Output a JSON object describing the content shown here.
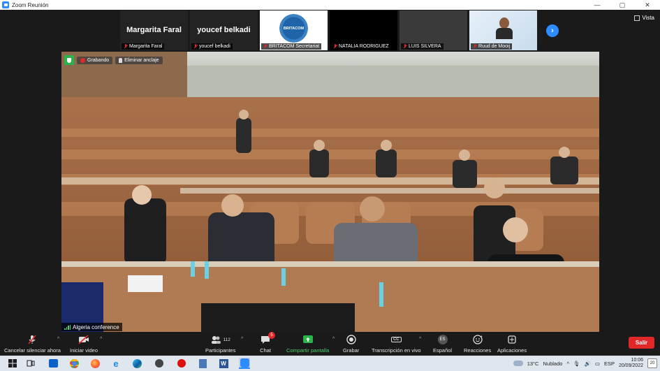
{
  "window": {
    "title": "Zoom Reunión",
    "minimize": "—",
    "maximize": "▢",
    "close": "✕"
  },
  "view_button": {
    "label": "Vista"
  },
  "gallery": [
    {
      "name": "Margarita Faral",
      "display": "Margarita Faral",
      "type": "name"
    },
    {
      "name": "youcef belkadi",
      "display": "youcef belkadi",
      "type": "name"
    },
    {
      "name": "BRITACOM Secretariat",
      "display": "BRITACOM",
      "type": "logo"
    },
    {
      "name": "NATALIA RODRIGUEZ",
      "display": "",
      "type": "dark"
    },
    {
      "name": "LUIS SILVERA",
      "display": "",
      "type": "grey"
    },
    {
      "name": "Ruud de Mooij",
      "display": "",
      "type": "video"
    }
  ],
  "main_video": {
    "recording_chip": "Grabando",
    "pin_chip": "Eliminar anclaje",
    "speaker": "Algeria conference"
  },
  "toolbar": {
    "mute": "Cancelar silenciar ahora",
    "video": "Iniciar video",
    "participants": "Participantes",
    "participants_count": "112",
    "chat": "Chat",
    "chat_badge": "5",
    "share": "Compartir pantalla",
    "record": "Grabar",
    "transcription": "Transcripción en vivo",
    "transcription_icon": "CC",
    "language": "Español",
    "language_icon": "ES",
    "reactions": "Reacciones",
    "apps": "Aplicaciones",
    "leave": "Salir"
  },
  "taskbar": {
    "weather_temp": "13°C",
    "weather_desc": "Nublado",
    "lang": "ESP",
    "time": "10:06",
    "date": "20/09/2022",
    "notif": "20"
  },
  "colors": {
    "accent": "#2d8cff",
    "leave": "#e02828",
    "share": "#2bb24c"
  }
}
